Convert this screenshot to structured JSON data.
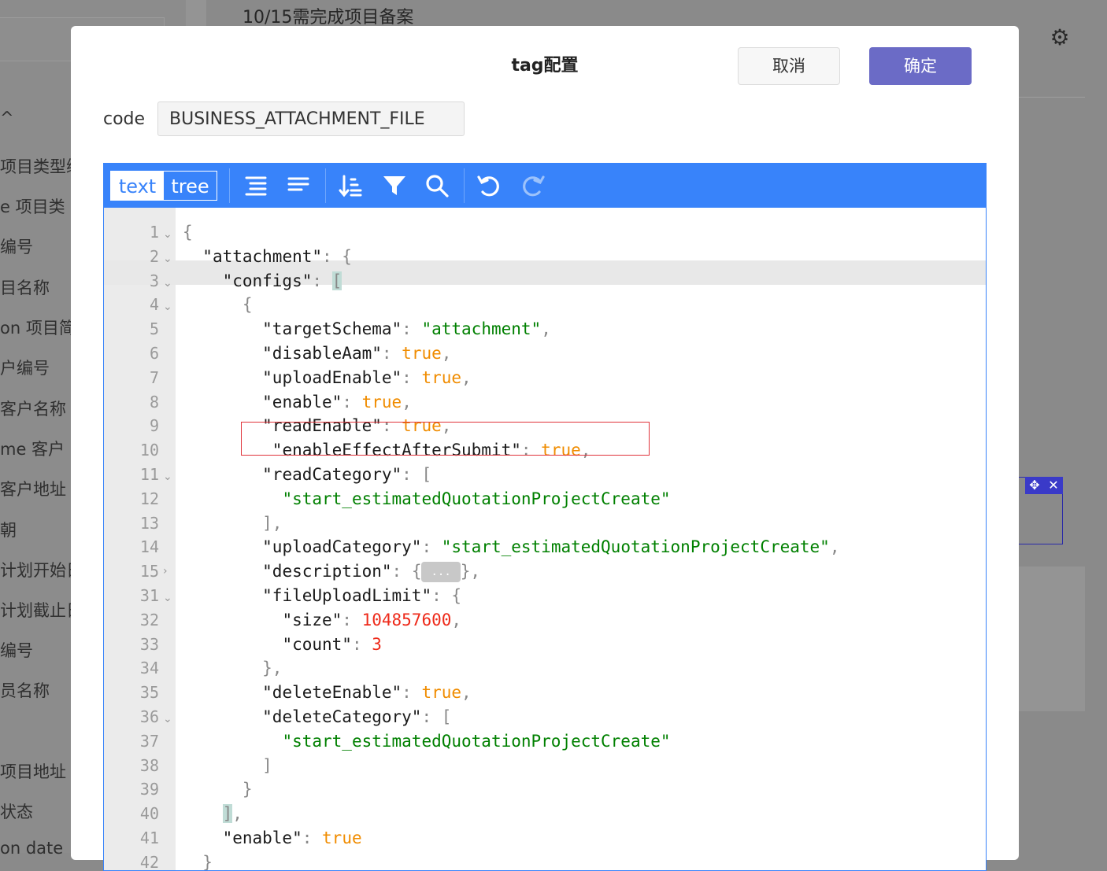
{
  "background": {
    "title": "10/15需完成项目备案",
    "side_labels": [
      "^",
      "项目类型编",
      "e  项目类",
      "编号",
      "目名称",
      "on  项目简",
      "户编号",
      "客户名称",
      "me  客户",
      "  客户地址",
      "朝",
      "计划开始日",
      "计划截止日",
      "编号",
      "员名称",
      "项目地址",
      "状态",
      "on date"
    ]
  },
  "modal": {
    "title": "tag配置",
    "cancel_label": "取消",
    "ok_label": "确定",
    "code_label": "code",
    "code_value": "BUSINESS_ATTACHMENT_FILE"
  },
  "editor": {
    "mode_text": "text",
    "mode_tree": "tree",
    "toolbar_icons": [
      "format-icon",
      "compact-icon",
      "sort-icon",
      "filter-icon",
      "search-icon",
      "undo-icon",
      "redo-icon"
    ],
    "lines": [
      {
        "num": "1",
        "fold": "v"
      },
      {
        "num": "2",
        "fold": "v"
      },
      {
        "num": "3",
        "fold": "v"
      },
      {
        "num": "4",
        "fold": "v"
      },
      {
        "num": "5",
        "fold": ""
      },
      {
        "num": "6",
        "fold": ""
      },
      {
        "num": "7",
        "fold": ""
      },
      {
        "num": "8",
        "fold": ""
      },
      {
        "num": "9",
        "fold": ""
      },
      {
        "num": "10",
        "fold": ""
      },
      {
        "num": "11",
        "fold": "v"
      },
      {
        "num": "12",
        "fold": ""
      },
      {
        "num": "13",
        "fold": ""
      },
      {
        "num": "14",
        "fold": ""
      },
      {
        "num": "15",
        "fold": ">"
      },
      {
        "num": "31",
        "fold": "v"
      },
      {
        "num": "32",
        "fold": ""
      },
      {
        "num": "33",
        "fold": ""
      },
      {
        "num": "34",
        "fold": ""
      },
      {
        "num": "35",
        "fold": ""
      },
      {
        "num": "36",
        "fold": "v"
      },
      {
        "num": "37",
        "fold": ""
      },
      {
        "num": "38",
        "fold": ""
      },
      {
        "num": "39",
        "fold": ""
      },
      {
        "num": "40",
        "fold": ""
      },
      {
        "num": "41",
        "fold": ""
      },
      {
        "num": "42",
        "fold": ""
      }
    ],
    "tokens": {
      "attachment_key": "\"attachment\"",
      "configs_key": "\"configs\"",
      "targetSchema_key": "\"targetSchema\"",
      "targetSchema_val": "\"attachment\"",
      "disableAam_key": "\"disableAam\"",
      "uploadEnable_key": "\"uploadEnable\"",
      "enable_key": "\"enable\"",
      "readEnable_key": "\"readEnable\"",
      "enableEffect_key": "\"enableEffectAfterSubmit\"",
      "readCategory_key": "\"readCategory\"",
      "category_val": "\"start_estimatedQuotationProjectCreate\"",
      "uploadCategory_key": "\"uploadCategory\"",
      "description_key": "\"description\"",
      "collapsed": "...",
      "fileUploadLimit_key": "\"fileUploadLimit\"",
      "size_key": "\"size\"",
      "size_val": "104857600",
      "count_key": "\"count\"",
      "count_val": "3",
      "deleteEnable_key": "\"deleteEnable\"",
      "deleteCategory_key": "\"deleteCategory\"",
      "true_val": "true"
    }
  },
  "colors": {
    "toolbar_blue": "#3883fa",
    "primary_button": "#6b6bc6",
    "string_green": "#008000",
    "boolean_orange": "#f08c00",
    "number_red": "#ee2a1a",
    "highlight_red": "#e0333a"
  }
}
